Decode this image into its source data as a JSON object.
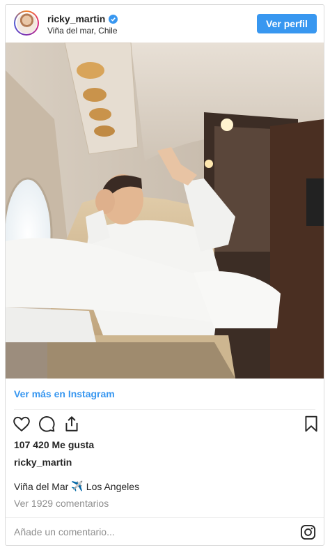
{
  "header": {
    "username": "ricky_martin",
    "location": "Viña del mar, Chile",
    "follow_label": "Ver perfil",
    "verified_icon": "verified-badge-icon"
  },
  "post": {
    "view_more_label": "Ver más en Instagram",
    "likes_text": "107 420 Me gusta",
    "owner": "ricky_martin",
    "caption_before": "Viña del Mar",
    "caption_emoji": "✈️",
    "caption_after": "Los Angeles",
    "comments_text": "Ver 1929 comentarios",
    "comment_placeholder": "Añade un comentario..."
  },
  "colors": {
    "accent": "#3897f0",
    "text": "#262626",
    "muted": "#8e8e8e"
  },
  "icons": [
    "heart-icon",
    "comment-icon",
    "share-icon",
    "bookmark-icon",
    "instagram-icon"
  ]
}
